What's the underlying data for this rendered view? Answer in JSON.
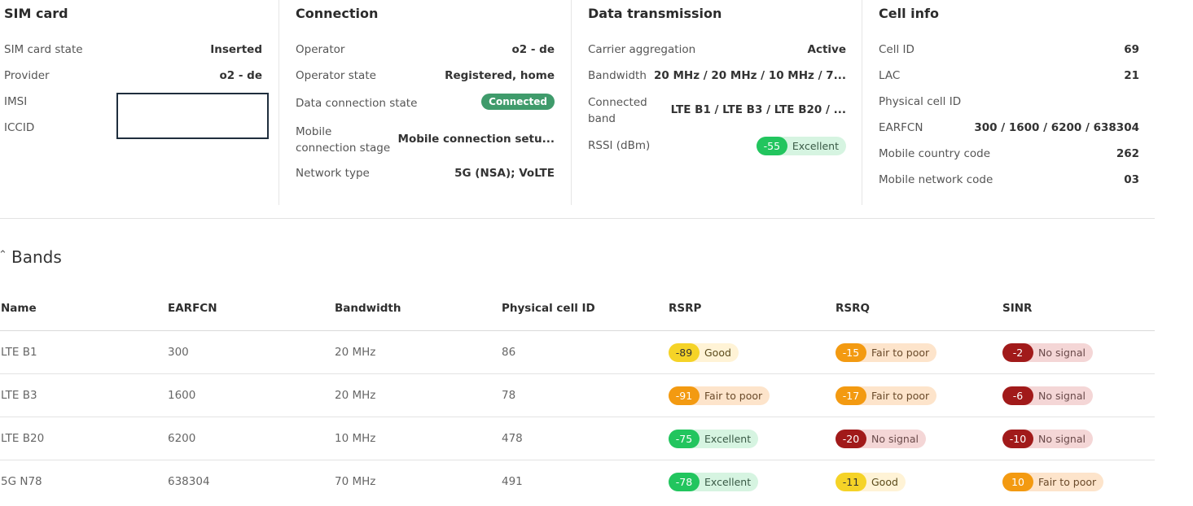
{
  "sim": {
    "title": "SIM card",
    "state_label": "SIM card state",
    "state_value": "Inserted",
    "provider_label": "Provider",
    "provider_value": "o2 - de",
    "imsi_label": "IMSI",
    "iccid_label": "ICCID"
  },
  "connection": {
    "title": "Connection",
    "operator_label": "Operator",
    "operator_value": "o2 - de",
    "opstate_label": "Operator state",
    "opstate_value": "Registered, home",
    "dcs_label": "Data connection state",
    "dcs_value": "Connected",
    "stage_label_1": "Mobile",
    "stage_label_2": "connection stage",
    "stage_value": "Mobile connection setu...",
    "nettype_label": "Network type",
    "nettype_value": "5G (NSA); VoLTE"
  },
  "data_tx": {
    "title": "Data transmission",
    "ca_label": "Carrier aggregation",
    "ca_value": "Active",
    "bw_label": "Bandwidth",
    "bw_value": "20 MHz / 20 MHz / 10 MHz / 7...",
    "cb_label_1": "Connected",
    "cb_label_2": "band",
    "cb_value": "LTE B1 / LTE B3 / LTE B20 / ...",
    "rssi_label": "RSSI (dBm)",
    "rssi_value": "-55",
    "rssi_quality": "Excellent"
  },
  "cell": {
    "title": "Cell info",
    "cellid_label": "Cell ID",
    "cellid_value": "69",
    "lac_label": "LAC",
    "lac_value": "21",
    "pci_label": "Physical cell ID",
    "earfcn_label": "EARFCN",
    "earfcn_value": "300 / 1600 / 6200 / 638304",
    "mcc_label": "Mobile country code",
    "mcc_value": "262",
    "mnc_label": "Mobile network code",
    "mnc_value": "03"
  },
  "bands": {
    "title": "Bands",
    "columns": [
      "Name",
      "EARFCN",
      "Bandwidth",
      "Physical cell ID",
      "RSRP",
      "RSRQ",
      "SINR"
    ],
    "rows": [
      {
        "name": "LTE B1",
        "earfcn": "300",
        "bandwidth": "20 MHz",
        "pci": "86",
        "rsrp": {
          "value": "-89",
          "label": "Good"
        },
        "rsrq": {
          "value": "-15",
          "label": "Fair to poor"
        },
        "sinr": {
          "value": "-2",
          "label": "No signal"
        }
      },
      {
        "name": "LTE B3",
        "earfcn": "1600",
        "bandwidth": "20 MHz",
        "pci": "78",
        "rsrp": {
          "value": "-91",
          "label": "Fair to poor"
        },
        "rsrq": {
          "value": "-17",
          "label": "Fair to poor"
        },
        "sinr": {
          "value": "-6",
          "label": "No signal"
        }
      },
      {
        "name": "LTE B20",
        "earfcn": "6200",
        "bandwidth": "10 MHz",
        "pci": "478",
        "rsrp": {
          "value": "-75",
          "label": "Excellent"
        },
        "rsrq": {
          "value": "-20",
          "label": "No signal"
        },
        "sinr": {
          "value": "-10",
          "label": "No signal"
        }
      },
      {
        "name": "5G N78",
        "earfcn": "638304",
        "bandwidth": "70 MHz",
        "pci": "491",
        "rsrp": {
          "value": "-78",
          "label": "Excellent"
        },
        "rsrq": {
          "value": "-11",
          "label": "Good"
        },
        "sinr": {
          "value": "10",
          "label": "Fair to poor"
        }
      }
    ]
  },
  "colors": {
    "connected_badge": "#3f9b6b",
    "excellent": "#22c55e",
    "good": "#f5d327",
    "fair_to_poor": "#f39a11",
    "no_signal": "#a11a1a"
  }
}
